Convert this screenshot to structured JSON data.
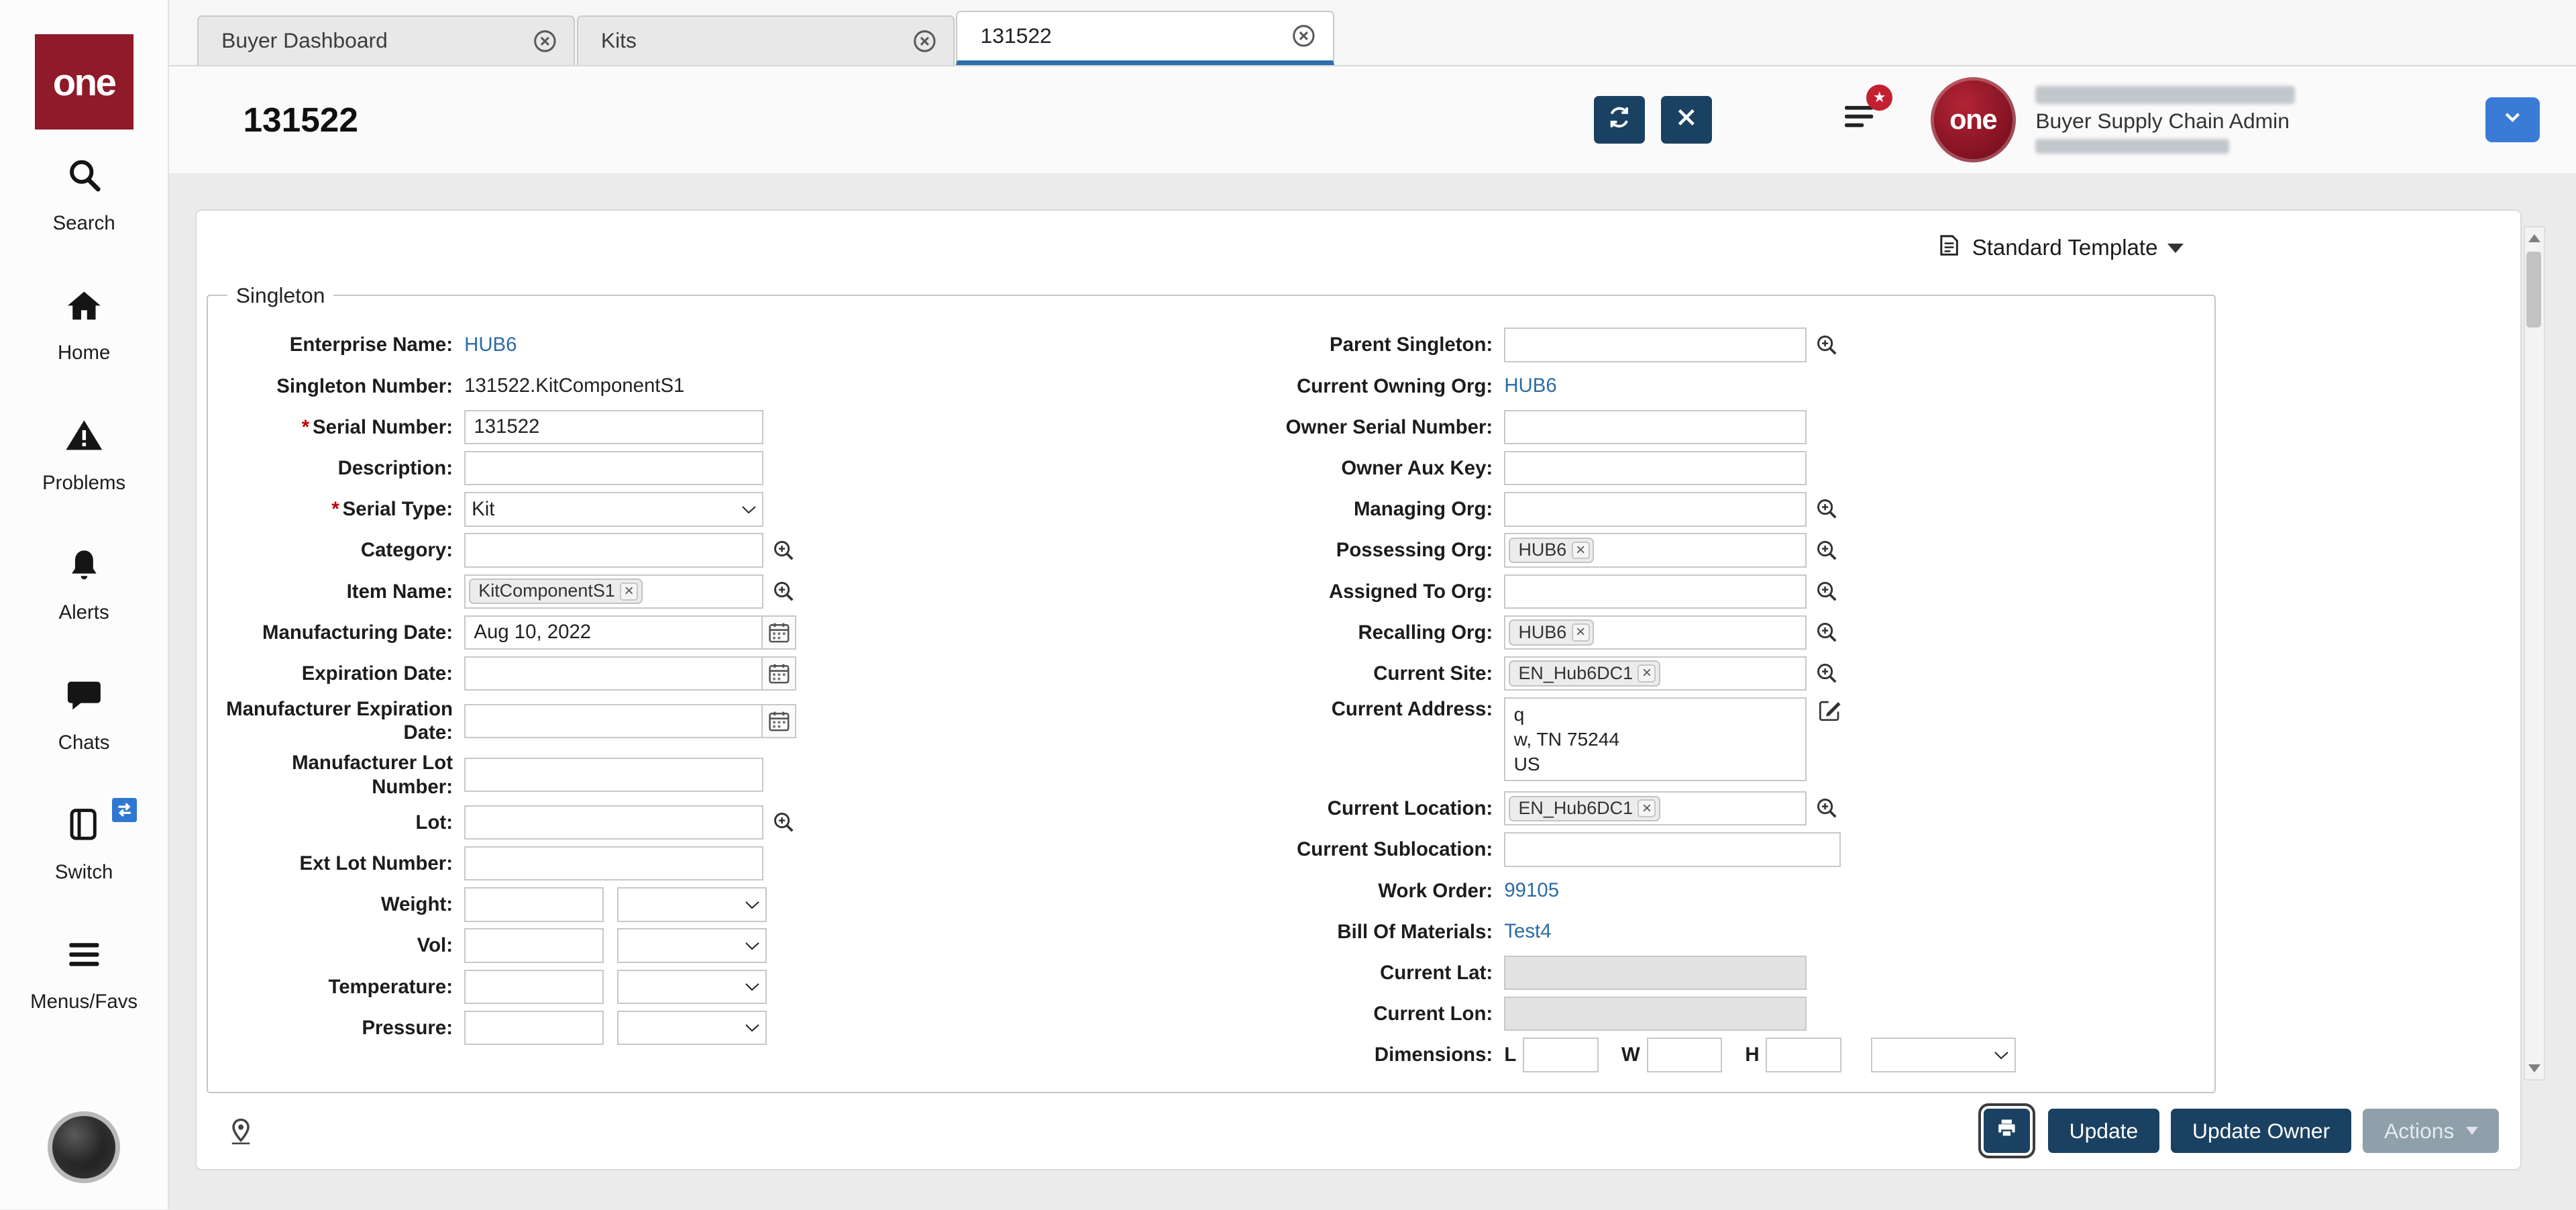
{
  "sidebar": {
    "logo_text": "one",
    "items": [
      {
        "label": "Search"
      },
      {
        "label": "Home"
      },
      {
        "label": "Problems"
      },
      {
        "label": "Alerts"
      },
      {
        "label": "Chats"
      },
      {
        "label": "Switch"
      },
      {
        "label": "Menus/Favs"
      }
    ]
  },
  "tabs": {
    "buyer_dashboard": "Buyer Dashboard",
    "kits": "Kits",
    "current": "131522"
  },
  "header": {
    "title": "131522",
    "logo_text": "one",
    "user_role": "Buyer Supply Chain Admin"
  },
  "panel": {
    "template_label": "Standard Template"
  },
  "form": {
    "legend": "Singleton",
    "enterprise_name": {
      "label": "Enterprise Name:",
      "value": "HUB6"
    },
    "singleton_number": {
      "label": "Singleton Number:",
      "value": "131522.KitComponentS1"
    },
    "serial_number": {
      "label": "Serial Number:",
      "required": "*",
      "value": "131522"
    },
    "description": {
      "label": "Description:",
      "value": ""
    },
    "serial_type": {
      "label": "Serial Type:",
      "required": "*",
      "value": "Kit"
    },
    "category": {
      "label": "Category:",
      "value": ""
    },
    "item_name": {
      "label": "Item Name:",
      "chip": "KitComponentS1"
    },
    "manufacturing_date": {
      "label": "Manufacturing Date:",
      "value": "Aug 10, 2022"
    },
    "expiration_date": {
      "label": "Expiration Date:",
      "value": ""
    },
    "manufacturer_expiration_date": {
      "label": "Manufacturer Expiration Date:",
      "value": ""
    },
    "manufacturer_lot_number": {
      "label": "Manufacturer Lot Number:",
      "value": ""
    },
    "lot": {
      "label": "Lot:",
      "value": ""
    },
    "ext_lot_number": {
      "label": "Ext Lot Number:",
      "value": ""
    },
    "weight": {
      "label": "Weight:",
      "value": ""
    },
    "vol": {
      "label": "Vol:",
      "value": ""
    },
    "temperature": {
      "label": "Temperature:",
      "value": ""
    },
    "pressure": {
      "label": "Pressure:",
      "value": ""
    },
    "parent_singleton": {
      "label": "Parent Singleton:",
      "value": ""
    },
    "current_owning_org": {
      "label": "Current Owning Org:",
      "value": "HUB6"
    },
    "owner_serial_number": {
      "label": "Owner Serial Number:",
      "value": ""
    },
    "owner_aux_key": {
      "label": "Owner Aux Key:",
      "value": ""
    },
    "managing_org": {
      "label": "Managing Org:",
      "value": ""
    },
    "possessing_org": {
      "label": "Possessing Org:",
      "chip": "HUB6"
    },
    "assigned_to_org": {
      "label": "Assigned To Org:",
      "value": ""
    },
    "recalling_org": {
      "label": "Recalling Org:",
      "chip": "HUB6"
    },
    "current_site": {
      "label": "Current Site:",
      "chip": "EN_Hub6DC1"
    },
    "current_address": {
      "label": "Current Address:",
      "line1": "q",
      "line2": "w, TN 75244",
      "line3": "US"
    },
    "current_location": {
      "label": "Current Location:",
      "chip": "EN_Hub6DC1"
    },
    "current_sublocation": {
      "label": "Current Sublocation:",
      "value": ""
    },
    "work_order": {
      "label": "Work Order:",
      "value": "99105"
    },
    "bill_of_materials": {
      "label": "Bill Of Materials:",
      "value": "Test4"
    },
    "current_lat": {
      "label": "Current Lat:",
      "value": ""
    },
    "current_lon": {
      "label": "Current Lon:",
      "value": ""
    },
    "dimensions": {
      "label": "Dimensions:",
      "l": "L",
      "w": "W",
      "h": "H",
      "value_l": "",
      "value_w": "",
      "value_h": ""
    }
  },
  "footer": {
    "update": "Update",
    "update_owner": "Update Owner",
    "actions": "Actions"
  }
}
